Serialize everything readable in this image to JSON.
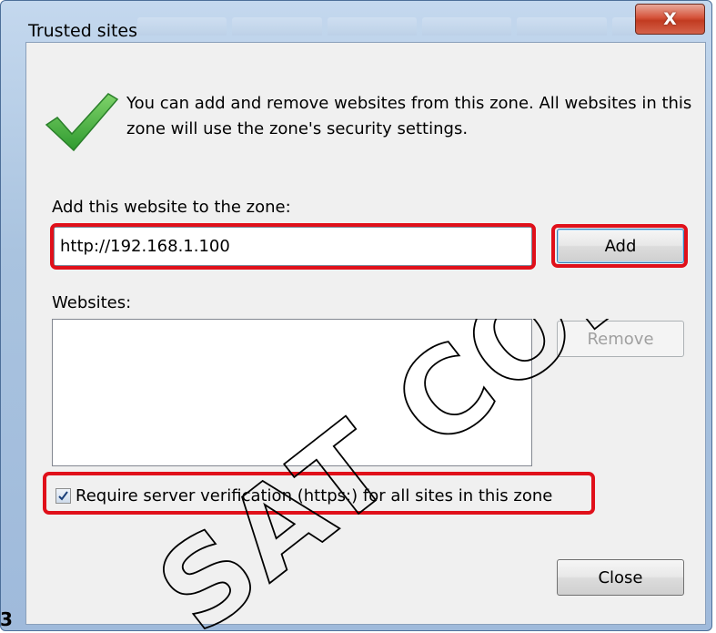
{
  "window": {
    "title": "Trusted sites",
    "close_glyph": "X"
  },
  "intro_text": "You can add and remove websites from this zone. All websites in this zone will use the zone's security settings.",
  "add_section": {
    "label": "Add this website to the zone:",
    "input_value": "http://192.168.1.100",
    "add_button": "Add"
  },
  "websites_section": {
    "label": "Websites:",
    "remove_button": "Remove"
  },
  "https_option": {
    "label": "Require server verification (https:) for all sites in this zone",
    "checked": true
  },
  "close_button": "Close",
  "watermark_text": "SAT CO.,LTD",
  "page_marker": "3",
  "colors": {
    "highlight": "#e0101a",
    "check": "#3aaa3a"
  },
  "icons": {
    "zone_icon": "green-checkmark-icon",
    "checkbox": "checkmark-icon",
    "close": "close-icon"
  }
}
